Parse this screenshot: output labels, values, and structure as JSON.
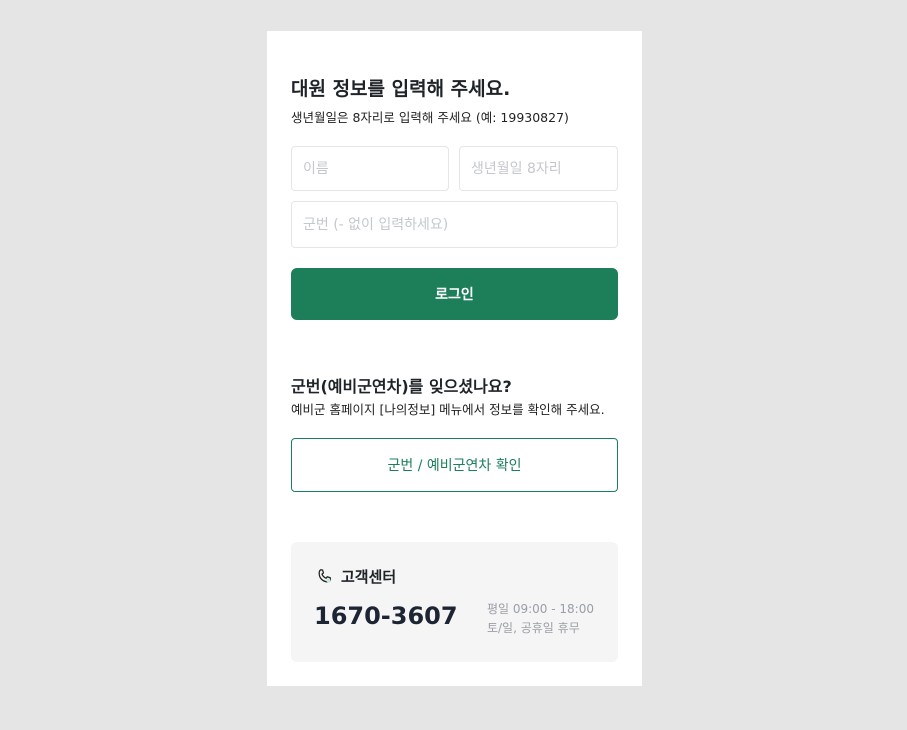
{
  "form": {
    "title": "대원 정보를 입력해 주세요.",
    "subtitle": "생년월일은 8자리로 입력해 주세요 (예: 19930827)",
    "name_placeholder": "이름",
    "birth_placeholder": "생년월일 8자리",
    "military_placeholder": "군번 (- 없이 입력하세요)",
    "login_label": "로그인"
  },
  "forgot": {
    "title": "군번(예비군연차)를 잊으셨나요?",
    "description": "예비군 홈페이지 [나의정보] 메뉴에서 정보를 확인해 주세요.",
    "check_label": "군번 / 예비군연차 확인"
  },
  "support": {
    "icon": "phone-icon",
    "title": "고객센터",
    "phone": "1670-3607",
    "hours_weekday": "평일 09:00 - 18:00",
    "hours_weekend": "토/일, 공휴일 휴무"
  },
  "colors": {
    "accent": "#1c7f5a",
    "background": "#e5e5e5"
  }
}
